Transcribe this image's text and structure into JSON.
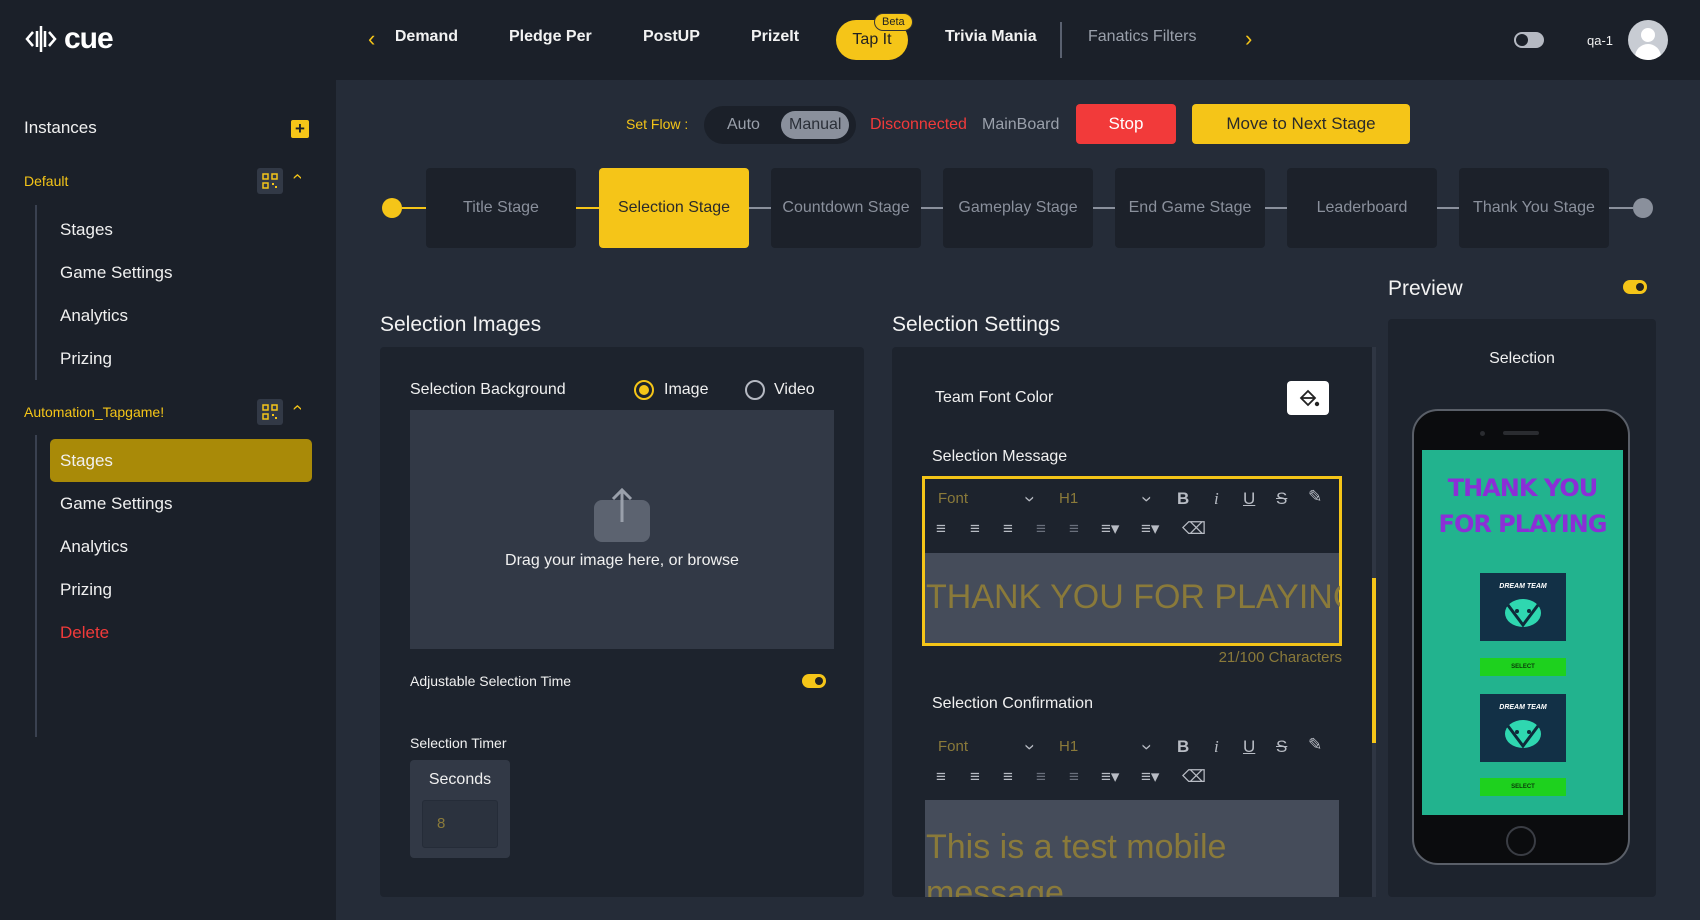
{
  "header": {
    "logo_text": "cue",
    "nav_items": [
      "Demand",
      "Pledge Per",
      "PostUP",
      "PrizeIt",
      "Tap It",
      "Trivia Mania",
      "Fanatics Filters"
    ],
    "beta_badge": "Beta",
    "user_name": "qa-1",
    "icons": [
      "chevron-left-icon",
      "chevron-right-icon",
      "theme-toggle-icon",
      "user-avatar-icon"
    ]
  },
  "sidebar": {
    "instances_label": "Instances",
    "groups": [
      {
        "name": "Default",
        "items": [
          "Stages",
          "Game Settings",
          "Analytics",
          "Prizing"
        ]
      },
      {
        "name": "Automation_Tapgame!",
        "items": [
          "Stages",
          "Game Settings",
          "Analytics",
          "Prizing",
          "Delete"
        ],
        "active_item": "Stages"
      }
    ]
  },
  "flow": {
    "set_flow_label": "Set Flow :",
    "auto_label": "Auto",
    "manual_label": "Manual",
    "selected": "Manual",
    "status": "Disconnected",
    "board": "MainBoard",
    "stop_label": "Stop",
    "next_label": "Move to Next Stage"
  },
  "stages": {
    "items": [
      "Title Stage",
      "Selection Stage",
      "Countdown Stage",
      "Gameplay Stage",
      "End Game Stage",
      "Leaderboard",
      "Thank You Stage"
    ],
    "active": "Selection Stage"
  },
  "images": {
    "title": "Selection Images",
    "background_label": "Selection Background",
    "options": [
      "Image",
      "Video"
    ],
    "selected_option": "Image",
    "drop_text": "Drag your image here, or browse",
    "adjustable_label": "Adjustable Selection Time",
    "adjustable_on": true,
    "timer_label": "Selection Timer",
    "seconds_label": "Seconds",
    "seconds_value": "8"
  },
  "settings": {
    "title": "Selection Settings",
    "team_font_color_label": "Team Font Color",
    "message_label": "Selection Message",
    "font_placeholder": "Font",
    "heading_value": "H1",
    "message_text": "THANK YOU FOR PLAYING",
    "char_count": "21/100 Characters",
    "confirmation_label": "Selection Confirmation",
    "confirmation_text": "This is a test mobile message"
  },
  "preview": {
    "title": "Preview",
    "enabled": true,
    "screen_title": "Selection",
    "phone_heading_line1": "THANK YOU",
    "phone_heading_line2": "FOR PLAYING",
    "team_name": "DREAM TEAM",
    "select_label": "SELECT",
    "colors": {
      "screen_bg": "#22b38e",
      "heading": "#8b2fd6",
      "select_btn": "#1ed11e"
    }
  },
  "colors": {
    "accent": "#f5c518",
    "danger": "#f23a3a",
    "bg": "#252c38",
    "panel": "#1d232d"
  }
}
